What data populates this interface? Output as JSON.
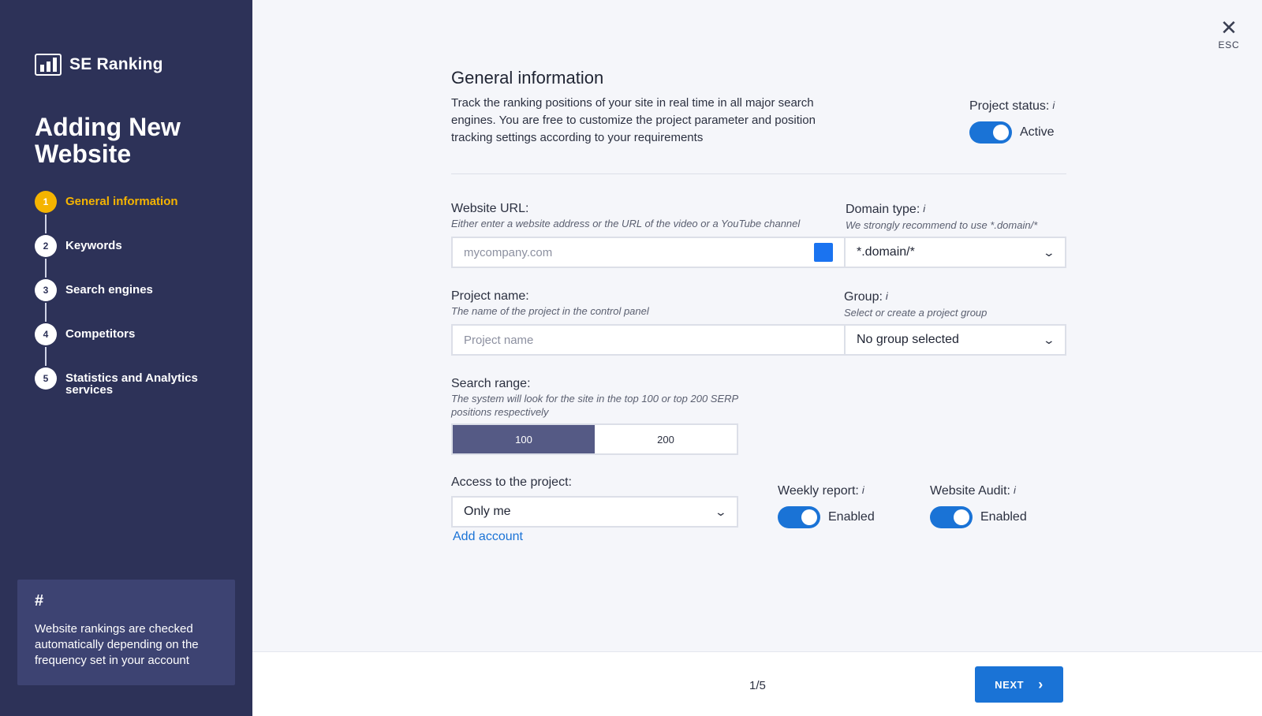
{
  "brand": {
    "name": "SE Ranking"
  },
  "sidebar": {
    "title": "Adding New Website",
    "steps": [
      {
        "num": "1",
        "label": "General information"
      },
      {
        "num": "2",
        "label": "Keywords"
      },
      {
        "num": "3",
        "label": "Search engines"
      },
      {
        "num": "4",
        "label": "Competitors"
      },
      {
        "num": "5",
        "label": "Statistics and Analytics services"
      }
    ],
    "tip": {
      "icon": "#",
      "text": "Website rankings are checked automatically depending on the frequency set in your account"
    }
  },
  "close": {
    "label": "ESC"
  },
  "header": {
    "title": "General information",
    "description": "Track the ranking positions of your site in real time in all major search engines. You are free to customize the project parameter and position tracking settings according to your requirements",
    "status_label": "Project status:",
    "status_value": "Active"
  },
  "website_url": {
    "label": "Website URL:",
    "hint": "Either enter a website address or the URL of the video or a YouTube channel",
    "placeholder": "mycompany.com"
  },
  "domain_type": {
    "label": "Domain type:",
    "hint": "We strongly recommend to use *.domain/*",
    "value": "*.domain/*"
  },
  "project_name": {
    "label": "Project name:",
    "hint": "The name of the project in the control panel",
    "placeholder": "Project name"
  },
  "group": {
    "label": "Group:",
    "hint": "Select or create a project group",
    "value": "No group selected"
  },
  "search_range": {
    "label": "Search range:",
    "hint": "The system will look for the site in the top 100 or top 200 SERP positions respectively",
    "options": [
      "100",
      "200"
    ],
    "selected": "100"
  },
  "access": {
    "label": "Access to the project:",
    "value": "Only me",
    "add_account": "Add account"
  },
  "weekly_report": {
    "label": "Weekly report:",
    "value": "Enabled"
  },
  "website_audit": {
    "label": "Website Audit:",
    "value": "Enabled"
  },
  "footer": {
    "pager": "1/5",
    "next_label": "NEXT"
  },
  "colors": {
    "sidebar": "#2d3258",
    "accent": "#1a73d6",
    "active_step": "#f5b400"
  }
}
